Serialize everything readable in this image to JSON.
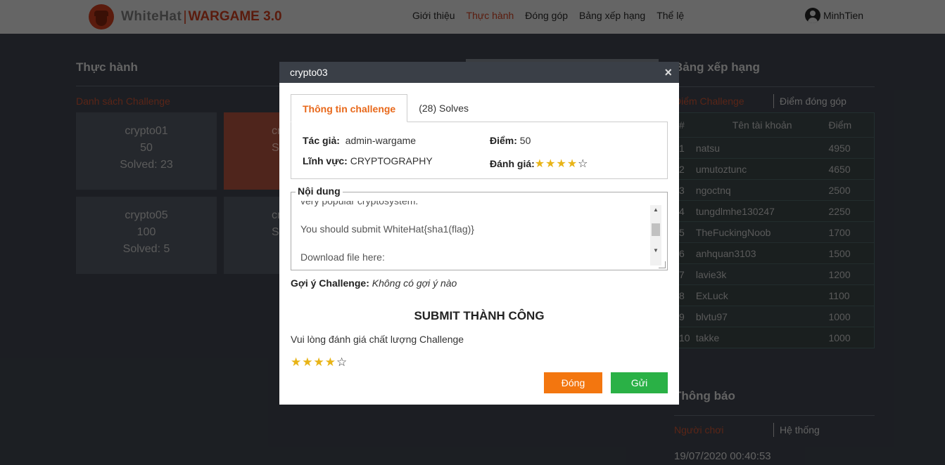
{
  "header": {
    "logo_text": "WhiteHat",
    "logo_sep": "|",
    "logo_sub": "WARGAME 3.0",
    "nav": [
      "Giới thiệu",
      "Thực hành",
      "Đóng góp",
      "Bảng xếp hạng",
      "Thể lệ"
    ],
    "nav_active_index": 1,
    "username": "MinhTien"
  },
  "left": {
    "title": "Thực hành",
    "list_label": "Danh sách Challenge",
    "cards": [
      {
        "name": "crypto01",
        "points": "50",
        "solved": "Solved: 23"
      },
      {
        "name": "cr",
        "points": "",
        "solved": "So"
      },
      {
        "name": "crypto05",
        "points": "100",
        "solved": "Solved: 5"
      },
      {
        "name": "cr",
        "points": "",
        "solved": "So"
      }
    ]
  },
  "ranking": {
    "title": "Bảng xếp hạng",
    "tab_points": "Điểm Challenge",
    "tab_contrib": "Điểm đóng góp",
    "headers": [
      "#",
      "Tên tài khoản",
      "Điểm"
    ],
    "rows": [
      [
        "1",
        "natsu",
        "4950"
      ],
      [
        "2",
        "umutoztunc",
        "4650"
      ],
      [
        "3",
        "ngoctnq",
        "2500"
      ],
      [
        "4",
        "tungdlmhe130247",
        "2250"
      ],
      [
        "5",
        "TheFuckingNoob",
        "1700"
      ],
      [
        "6",
        "anhquan3103",
        "1500"
      ],
      [
        "7",
        "lavie3k",
        "1200"
      ],
      [
        "8",
        "ExLuck",
        "1100"
      ],
      [
        "9",
        "blvtu97",
        "1000"
      ],
      [
        "10",
        "takke",
        "1000"
      ]
    ]
  },
  "notice": {
    "title": "Thông báo",
    "tab_players": "Người chơi",
    "tab_system": "Hệ thống",
    "timestamp": "19/07/2020 00:40:53"
  },
  "modal": {
    "title": "crypto03",
    "close_icon": "×",
    "tab_info": "Thông tin challenge",
    "tab_solves": "(28) Solves",
    "author_label": "Tác giả:",
    "author_value": "admin-wargame",
    "field_label": "Lĩnh vực:",
    "field_value": "CRYPTOGRAPHY",
    "score_label": "Điểm:",
    "score_value": "50",
    "rating_label": "Đánh giá:",
    "rating_stars": "★★★★",
    "rating_empty": "☆",
    "content_legend": "Nội dung",
    "content_lines": [
      "very popular cryptosystem.",
      "",
      "You should submit WhiteHat{sha1(flag)}",
      "",
      "Download file here:"
    ],
    "hint_label": "Gợi ý Challenge:",
    "hint_value": "Không có gợi ý nào",
    "success_text": "SUBMIT THÀNH CÔNG",
    "rate_prompt": "Vui lòng đánh giá chất lượng Challenge",
    "rate_stars": "★★★★",
    "rate_empty": "☆",
    "btn_close": "Đóng",
    "btn_send": "Gửi"
  },
  "colors": {
    "accent_orange": "#f3760f",
    "send_green": "#2ab146",
    "brand_red": "#8a2a14",
    "star": "#e8b417"
  }
}
